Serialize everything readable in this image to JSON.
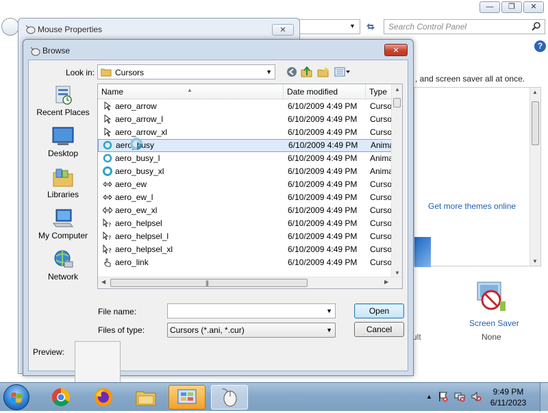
{
  "control_panel": {
    "search_placeholder": "Search Control Panel",
    "description_fragment": ", and screen saver all at once.",
    "get_more_themes": "Get more themes online",
    "screen_saver_label": "Screen Saver",
    "screen_saver_value": "None",
    "default_fragment": "ult"
  },
  "mouse_properties": {
    "title": "Mouse Properties"
  },
  "browse": {
    "title": "Browse",
    "look_in_label": "Look in:",
    "look_in_value": "Cursors",
    "places": [
      {
        "label": "Recent Places",
        "icon": "recent-places-icon"
      },
      {
        "label": "Desktop",
        "icon": "desktop-icon"
      },
      {
        "label": "Libraries",
        "icon": "libraries-icon"
      },
      {
        "label": "My Computer",
        "icon": "computer-icon"
      },
      {
        "label": "Network",
        "icon": "network-icon"
      }
    ],
    "columns": {
      "name": "Name",
      "date": "Date modified",
      "type": "Type"
    },
    "files": [
      {
        "name": "aero_arrow",
        "date": "6/10/2009 4:49 PM",
        "type": "Cursor"
      },
      {
        "name": "aero_arrow_l",
        "date": "6/10/2009 4:49 PM",
        "type": "Cursor"
      },
      {
        "name": "aero_arrow_xl",
        "date": "6/10/2009 4:49 PM",
        "type": "Cursor"
      },
      {
        "name": "aero_busy",
        "date": "6/10/2009 4:49 PM",
        "type": "Animated"
      },
      {
        "name": "aero_busy_l",
        "date": "6/10/2009 4:49 PM",
        "type": "Animated"
      },
      {
        "name": "aero_busy_xl",
        "date": "6/10/2009 4:49 PM",
        "type": "Animated"
      },
      {
        "name": "aero_ew",
        "date": "6/10/2009 4:49 PM",
        "type": "Cursor"
      },
      {
        "name": "aero_ew_l",
        "date": "6/10/2009 4:49 PM",
        "type": "Cursor"
      },
      {
        "name": "aero_ew_xl",
        "date": "6/10/2009 4:49 PM",
        "type": "Cursor"
      },
      {
        "name": "aero_helpsel",
        "date": "6/10/2009 4:49 PM",
        "type": "Cursor"
      },
      {
        "name": "aero_helpsel_l",
        "date": "6/10/2009 4:49 PM",
        "type": "Cursor"
      },
      {
        "name": "aero_helpsel_xl",
        "date": "6/10/2009 4:49 PM",
        "type": "Cursor"
      },
      {
        "name": "aero_link",
        "date": "6/10/2009 4:49 PM",
        "type": "Cursor"
      }
    ],
    "selected_index": 3,
    "file_name_label": "File name:",
    "file_name_value": "",
    "files_of_type_label": "Files of type:",
    "files_of_type_value": "Cursors (*.ani, *.cur)",
    "open_button": "Open",
    "cancel_button": "Cancel",
    "preview_label": "Preview:"
  },
  "taskbar": {
    "time": "9:49 PM",
    "date": "6/11/2023"
  }
}
